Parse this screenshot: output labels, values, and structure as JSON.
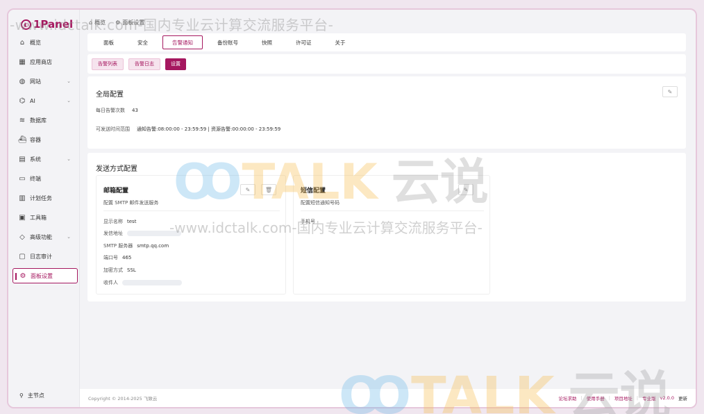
{
  "brand": {
    "name": "1Panel"
  },
  "watermark": {
    "text": "-www.idctalk.com-国内专业云计算交流服务平台-",
    "logo_a": "TALK",
    "logo_b": "云说"
  },
  "breadcrumb": {
    "items": [
      "概览",
      "面板设置"
    ]
  },
  "sidebar": {
    "items": [
      {
        "label": "概览",
        "icon": "home-icon",
        "chev": ""
      },
      {
        "label": "应用商店",
        "icon": "apps-icon",
        "chev": ""
      },
      {
        "label": "网站",
        "icon": "globe-icon",
        "chev": "⌄"
      },
      {
        "label": "AI",
        "icon": "robot-icon",
        "chev": "⌄"
      },
      {
        "label": "数据库",
        "icon": "layers-icon",
        "chev": ""
      },
      {
        "label": "容器",
        "icon": "container-icon",
        "chev": ""
      },
      {
        "label": "系统",
        "icon": "system-icon",
        "chev": "⌄"
      },
      {
        "label": "终端",
        "icon": "terminal-icon",
        "chev": ""
      },
      {
        "label": "计划任务",
        "icon": "calendar-icon",
        "chev": ""
      },
      {
        "label": "工具箱",
        "icon": "toolbox-icon",
        "chev": ""
      },
      {
        "label": "高级功能",
        "icon": "diamond-icon",
        "chev": "⌄"
      },
      {
        "label": "日志审计",
        "icon": "log-icon",
        "chev": ""
      },
      {
        "label": "面板设置",
        "icon": "gear-icon",
        "chev": ""
      }
    ],
    "footer_label": "主节点"
  },
  "tabs": [
    "面板",
    "安全",
    "告警通知",
    "备份账号",
    "快照",
    "许可证",
    "关于"
  ],
  "subtabs": [
    "告警列表",
    "告警日志",
    "设置"
  ],
  "global": {
    "title": "全局配置",
    "daily_label": "每日告警次数",
    "daily_value": "43",
    "time_label": "可发送时间范围",
    "time_value": "通知告警:08:00:00 - 23:59:59 | 资源告警:00:00:00 - 23:59:59"
  },
  "send": {
    "title": "发送方式配置",
    "email": {
      "title": "邮箱配置",
      "desc": "配置 SMTP 邮件发送服务",
      "name_label": "显示名称",
      "name_value": "test",
      "from_label": "发信地址",
      "smtp_label": "SMTP 服务器",
      "smtp_value": "smtp.qq.com",
      "port_label": "端口号",
      "port_value": "465",
      "enc_label": "加密方式",
      "enc_value": "SSL",
      "to_label": "收件人"
    },
    "sms": {
      "title": "短信配置",
      "desc": "配置短信通知号码",
      "phone_label": "手机号"
    }
  },
  "footer": {
    "copyright": "Copyright © 2014-2025 飞致云",
    "links": [
      "论坛求助",
      "使用手册",
      "项目地址",
      "专业版"
    ],
    "version": "v2.0.0",
    "update": "更新"
  },
  "colors": {
    "accent": "#a5175f"
  }
}
